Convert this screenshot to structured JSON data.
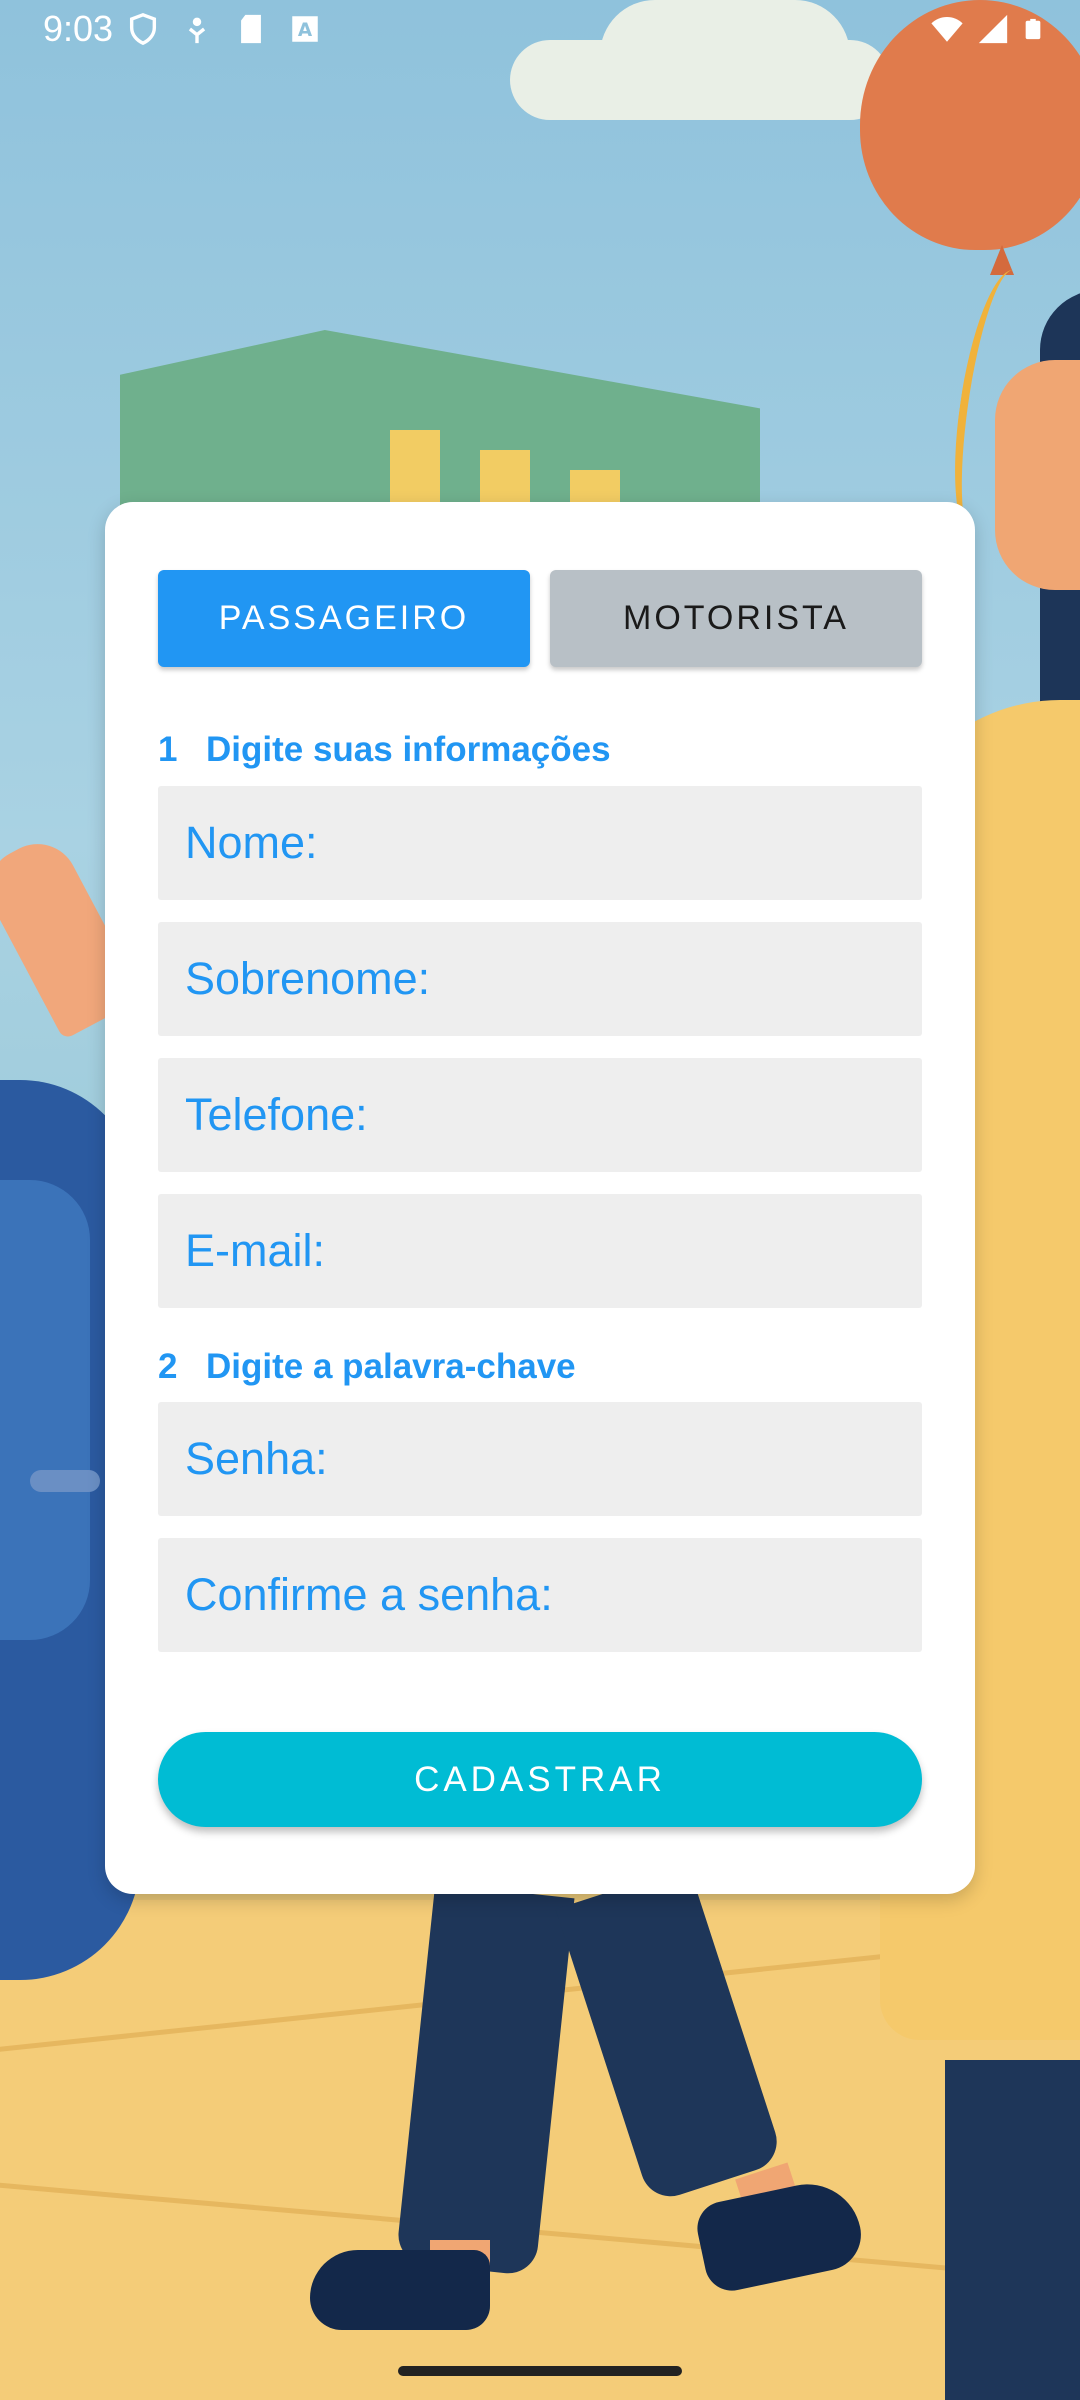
{
  "status_bar": {
    "time": "9:03",
    "left_icons": [
      "shield-icon",
      "usb-debug-icon",
      "sd-card-icon",
      "font-icon"
    ],
    "right_icons": [
      "wifi-icon",
      "cellular-signal-icon",
      "battery-icon"
    ]
  },
  "tabs": [
    {
      "label": "PASSAGEIRO",
      "selected": true,
      "color": "#2196f3"
    },
    {
      "label": "MOTORISTA",
      "selected": false,
      "color": "#b8c0c6"
    }
  ],
  "sections": [
    {
      "number": "1",
      "title": "Digite suas informações"
    },
    {
      "number": "2",
      "title": "Digite a palavra-chave"
    }
  ],
  "fields": {
    "nome": {
      "placeholder": "Nome:"
    },
    "sobrenome": {
      "placeholder": "Sobrenome:"
    },
    "telefone": {
      "placeholder": "Telefone:"
    },
    "email": {
      "placeholder": "E-mail:"
    },
    "senha": {
      "placeholder": "Senha:"
    },
    "confirme_senha": {
      "placeholder": "Confirme a senha:"
    }
  },
  "submit": {
    "label": "CADASTRAR",
    "color": "#00bcd4"
  },
  "colors": {
    "accent": "#2196f3",
    "field_bg": "#eeeeee",
    "card_bg": "#ffffff"
  }
}
